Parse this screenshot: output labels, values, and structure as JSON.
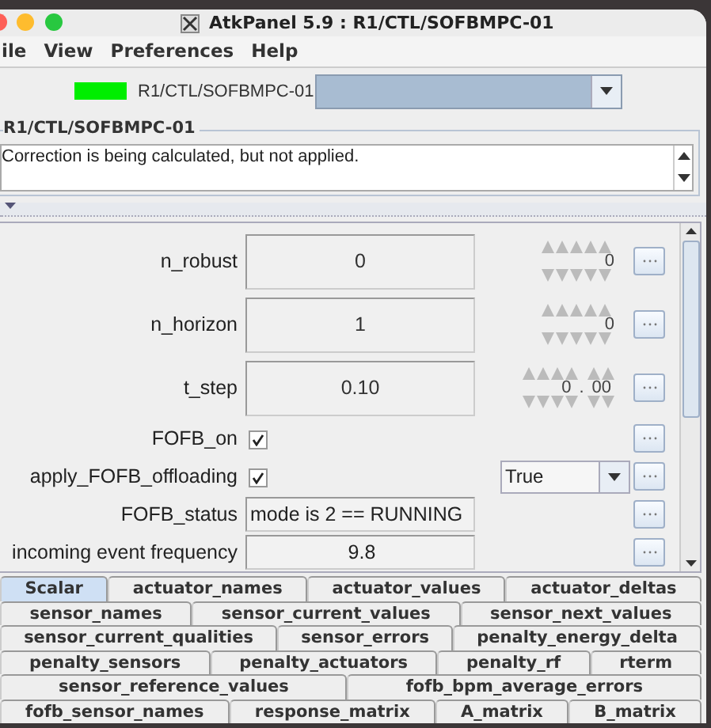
{
  "window": {
    "title": "AtkPanel 5.9 : R1/CTL/SOFBMPC-01"
  },
  "menu": [
    "ile",
    "View",
    "Preferences",
    "Help"
  ],
  "device": {
    "color": "#00ee00",
    "name": "R1/CTL/SOFBMPC-01"
  },
  "status": {
    "title": "R1/CTL/SOFBMPC-01",
    "text": "Correction is being calculated, but not applied."
  },
  "attributes": [
    {
      "kind": "number",
      "label": "n_robust",
      "value": "0",
      "spinner": "0"
    },
    {
      "kind": "number",
      "label": "n_horizon",
      "value": "1",
      "spinner": "0"
    },
    {
      "kind": "decimal",
      "label": "t_step",
      "value": "0.10",
      "spinner": "0",
      "spinner_separator": ".",
      "spinner_fraction": "00"
    },
    {
      "kind": "boolean",
      "label": "FOFB_on",
      "checked": true
    },
    {
      "kind": "boolean",
      "label": "apply_FOFB_offloading",
      "checked": true,
      "setter": "True"
    },
    {
      "kind": "text",
      "label": "FOFB_status",
      "value": "mode is 2 == RUNNING"
    },
    {
      "kind": "scalar",
      "label": "incoming event frequency",
      "value": "9.8"
    }
  ],
  "tab_rows": [
    [
      {
        "label": "Scalar",
        "selected": true
      },
      {
        "label": "actuator_names",
        "selected": false
      },
      {
        "label": "actuator_values",
        "selected": false
      },
      {
        "label": "actuator_deltas",
        "selected": false
      }
    ],
    [
      {
        "label": "sensor_names",
        "selected": false
      },
      {
        "label": "sensor_current_values",
        "selected": false
      },
      {
        "label": "sensor_next_values",
        "selected": false
      }
    ],
    [
      {
        "label": "sensor_current_qualities",
        "selected": false
      },
      {
        "label": "sensor_errors",
        "selected": false
      },
      {
        "label": "penalty_energy_delta",
        "selected": false
      }
    ],
    [
      {
        "label": "penalty_sensors",
        "selected": false
      },
      {
        "label": "penalty_actuators",
        "selected": false
      },
      {
        "label": "penalty_rf",
        "selected": false
      },
      {
        "label": "rterm",
        "selected": false
      }
    ],
    [
      {
        "label": "sensor_reference_values",
        "selected": false
      },
      {
        "label": "fofb_bpm_average_errors",
        "selected": false
      }
    ],
    [
      {
        "label": "fofb_sensor_names",
        "selected": false
      },
      {
        "label": "response_matrix",
        "selected": false
      },
      {
        "label": "A_matrix",
        "selected": false
      },
      {
        "label": "B_matrix",
        "selected": false
      }
    ]
  ]
}
